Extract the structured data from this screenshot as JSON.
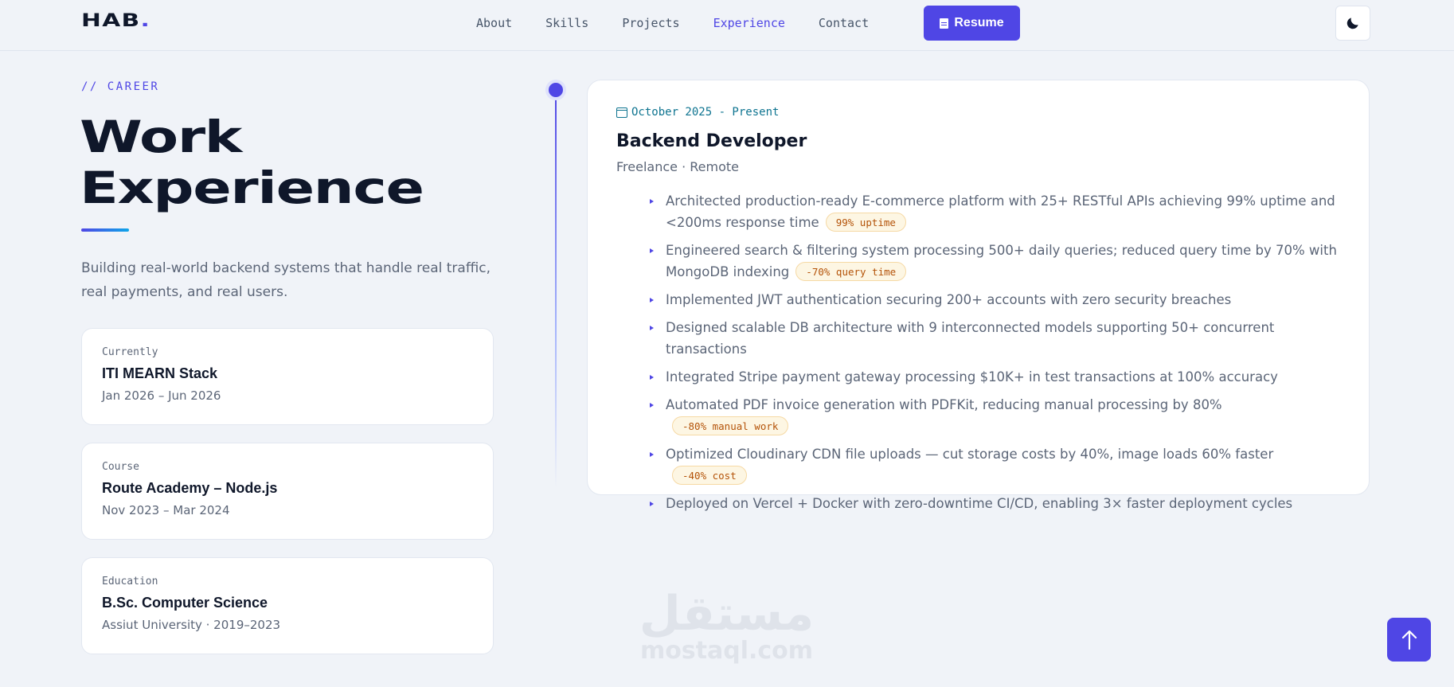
{
  "nav": {
    "logo_text": "HAB",
    "logo_dot": ".",
    "links": [
      "About",
      "Skills",
      "Projects",
      "Experience",
      "Contact"
    ],
    "active_link": "Experience",
    "resume_label": "Resume",
    "theme_icon": "moon-icon"
  },
  "hero": {
    "eyebrow": "// CAREER",
    "title_line1": "Work",
    "title_line2": "Experience",
    "intro": "Building real-world backend systems that handle real traffic, real payments, and real users."
  },
  "side_cards": [
    {
      "label": "Currently",
      "name": "ITI MEARN Stack",
      "meta": "Jan 2026 – Jun 2026"
    },
    {
      "label": "Course",
      "name": "Route Academy – Node.js",
      "meta": "Nov 2023 – Mar 2024"
    },
    {
      "label": "Education",
      "name": "B.Sc. Computer Science",
      "meta": "Assiut University · 2019–2023"
    }
  ],
  "experience": {
    "date": "October 2025 - Present",
    "role": "Backend Developer",
    "org": "Freelance · Remote",
    "bullets": [
      {
        "text": "Architected production-ready E-commerce platform with 25+ RESTful APIs achieving 99% uptime and <200ms response time",
        "badge": "99% uptime"
      },
      {
        "text": "Engineered search & filtering system processing 500+ daily queries; reduced query time by 70% with MongoDB indexing",
        "badge": "-70% query time"
      },
      {
        "text": "Implemented JWT authentication securing 200+ accounts with zero security breaches",
        "badge": ""
      },
      {
        "text": "Designed scalable DB architecture with 9 interconnected models supporting 50+ concurrent transactions",
        "badge": ""
      },
      {
        "text": "Integrated Stripe payment gateway processing $10K+ in test transactions at 100% accuracy",
        "badge": ""
      },
      {
        "text": "Automated PDF invoice generation with PDFKit, reducing manual processing by 80%",
        "badge": "-80% manual work"
      },
      {
        "text": "Optimized Cloudinary CDN file uploads — cut storage costs by 40%, image loads 60% faster",
        "badge": "-40% cost"
      },
      {
        "text": "Deployed on Vercel + Docker with zero-downtime CI/CD, enabling 3× faster deployment cycles",
        "badge": ""
      }
    ]
  },
  "watermark": {
    "arabic": "مستقل",
    "latin": "mostaql.com"
  },
  "colors": {
    "accent": "#4f46e5",
    "date": "#0e7490",
    "badge_text": "#b45309",
    "badge_bg": "#fdf6e3"
  }
}
